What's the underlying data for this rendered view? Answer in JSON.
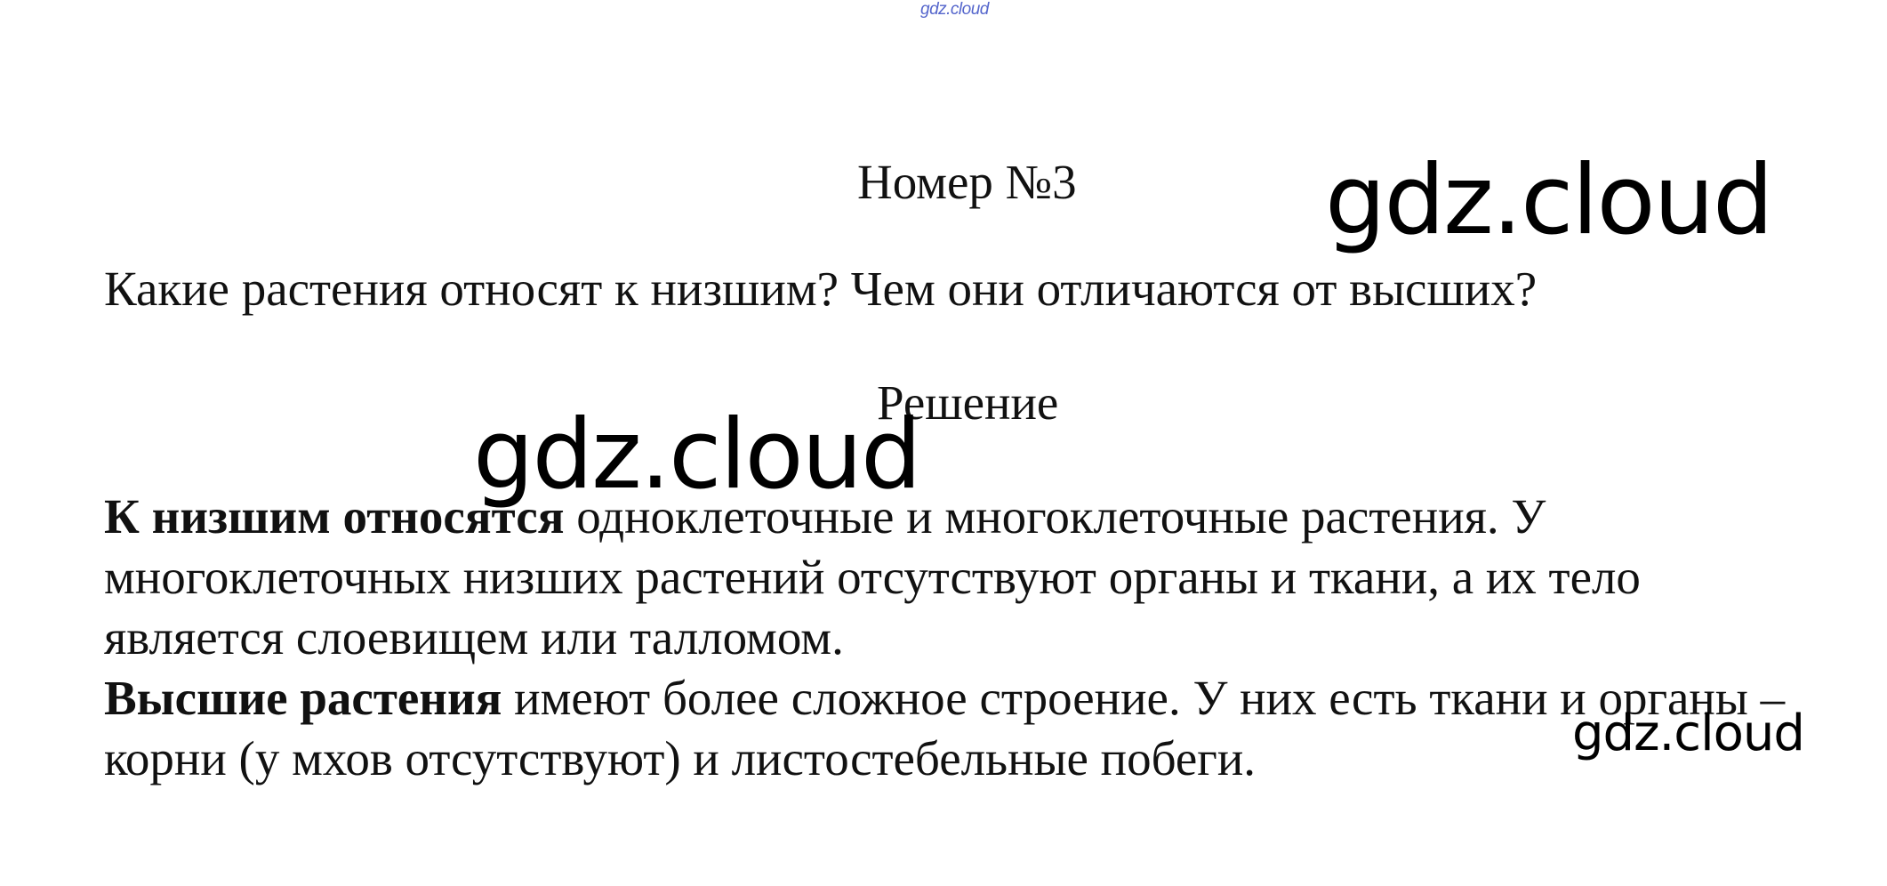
{
  "watermarks": {
    "small": "gdz.cloud",
    "top_right": "gdz.cloud",
    "middle_left": "gdz.cloud",
    "bottom_right": "gdz.cloud"
  },
  "header": {
    "number_title": "Номер №3"
  },
  "question": {
    "text": "Какие растения относят к низшим? Чем они отличаются от высших?"
  },
  "solution": {
    "label": "Решение",
    "paragraphs": [
      {
        "bold": "К низшим относятся",
        "text": " одноклеточные и многоклеточные растения. У многоклеточных низших растений отсутствуют органы и ткани, а их тело является слоевищем или талломом."
      },
      {
        "bold": "Высшие растения",
        "text": " имеют более сложное строение. У них есть ткани и органы – корни (у мхов отсутствуют) и листостебельные побеги."
      }
    ]
  }
}
